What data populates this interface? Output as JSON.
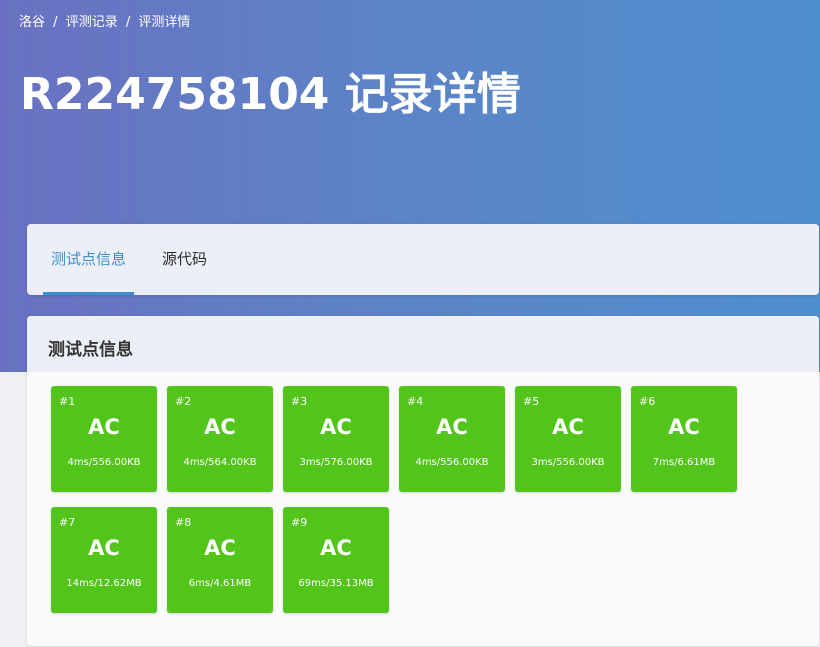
{
  "breadcrumb": {
    "items": [
      "洛谷",
      "评测记录",
      "评测详情"
    ],
    "separator": "/"
  },
  "page": {
    "title": "R224758104 记录详情"
  },
  "tabs": [
    {
      "label": "测试点信息",
      "active": true
    },
    {
      "label": "源代码",
      "active": false
    }
  ],
  "cases_section": {
    "title": "测试点信息"
  },
  "test_cases": [
    {
      "id": "#1",
      "status": "AC",
      "info": "4ms/556.00KB"
    },
    {
      "id": "#2",
      "status": "AC",
      "info": "4ms/564.00KB"
    },
    {
      "id": "#3",
      "status": "AC",
      "info": "3ms/576.00KB"
    },
    {
      "id": "#4",
      "status": "AC",
      "info": "4ms/556.00KB"
    },
    {
      "id": "#5",
      "status": "AC",
      "info": "3ms/556.00KB"
    },
    {
      "id": "#6",
      "status": "AC",
      "info": "7ms/6.61MB"
    },
    {
      "id": "#7",
      "status": "AC",
      "info": "14ms/12.62MB"
    },
    {
      "id": "#8",
      "status": "AC",
      "info": "6ms/4.61MB"
    },
    {
      "id": "#9",
      "status": "AC",
      "info": "69ms/35.13MB"
    }
  ],
  "colors": {
    "accepted": "#52c41a",
    "tab_active": "#3e90cc",
    "hero_start": "#6a71c2",
    "hero_end": "#4f8fcf"
  }
}
